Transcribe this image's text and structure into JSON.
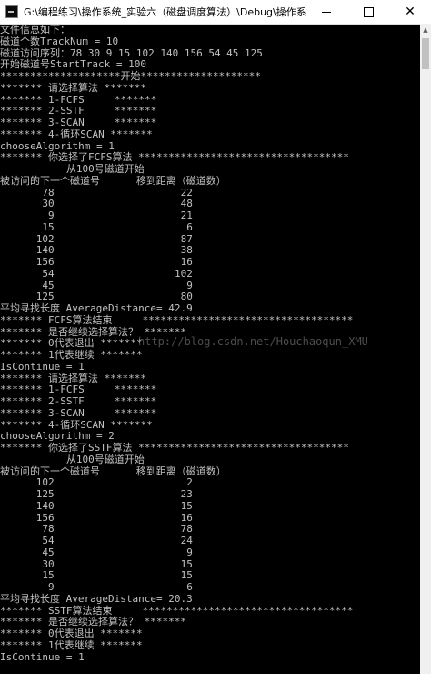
{
  "window": {
    "title": "G:\\编程练习\\操作系统_实验六（磁盘调度算法）\\Debug\\操作系统_实验六 (...",
    "minimize": "—",
    "maximize": "☐",
    "close": "✕"
  },
  "watermark": "http://blog.csdn.net/Houchaoqun_XMU",
  "console_lines": [
    "文件信息如下：",
    "磁道个数TrackNum = 10",
    "磁道访问序列：78 30 9 15 102 140 156 54 45 125",
    "开始磁道号StartTrack = 100",
    "********************开始********************",
    "******* 请选择算法 *******",
    "******* 1-FCFS     *******",
    "******* 2-SSTF     *******",
    "******* 3-SCAN     *******",
    "******* 4-循环SCAN *******",
    "chooseAlgorithm = 1",
    "******* 你选择了FCFS算法 ***********************************",
    "           从100号磁道开始",
    "被访问的下一个磁道号      移到距离（磁道数）",
    "       78                     22",
    "       30                     48",
    "        9                     21",
    "       15                      6",
    "      102                     87",
    "      140                     38",
    "      156                     16",
    "       54                    102",
    "       45                      9",
    "      125                     80",
    "平均寻找长度 AverageDistance= 42.9",
    "******* FCFS算法结束     ***********************************",
    "******* 是否继续选择算法？ *******",
    "******* 0代表退出 *******",
    "******* 1代表继续 *******",
    "IsContinue = 1",
    "******* 请选择算法 *******",
    "******* 1-FCFS     *******",
    "******* 2-SSTF     *******",
    "******* 3-SCAN     *******",
    "******* 4-循环SCAN *******",
    "chooseAlgorithm = 2",
    "******* 你选择了SSTF算法 ***********************************",
    "           从100号磁道开始",
    "被访问的下一个磁道号      移到距离（磁道数）",
    "      102                      2",
    "      125                     23",
    "      140                     15",
    "      156                     16",
    "       78                     78",
    "       54                     24",
    "       45                      9",
    "       30                     15",
    "       15                     15",
    "        9                      6",
    "平均寻找长度 AverageDistance= 20.3",
    "******* SSTF算法结束     ***********************************",
    "******* 是否继续选择算法？ *******",
    "******* 0代表退出 *******",
    "******* 1代表继续 *******",
    "IsContinue = 1"
  ]
}
